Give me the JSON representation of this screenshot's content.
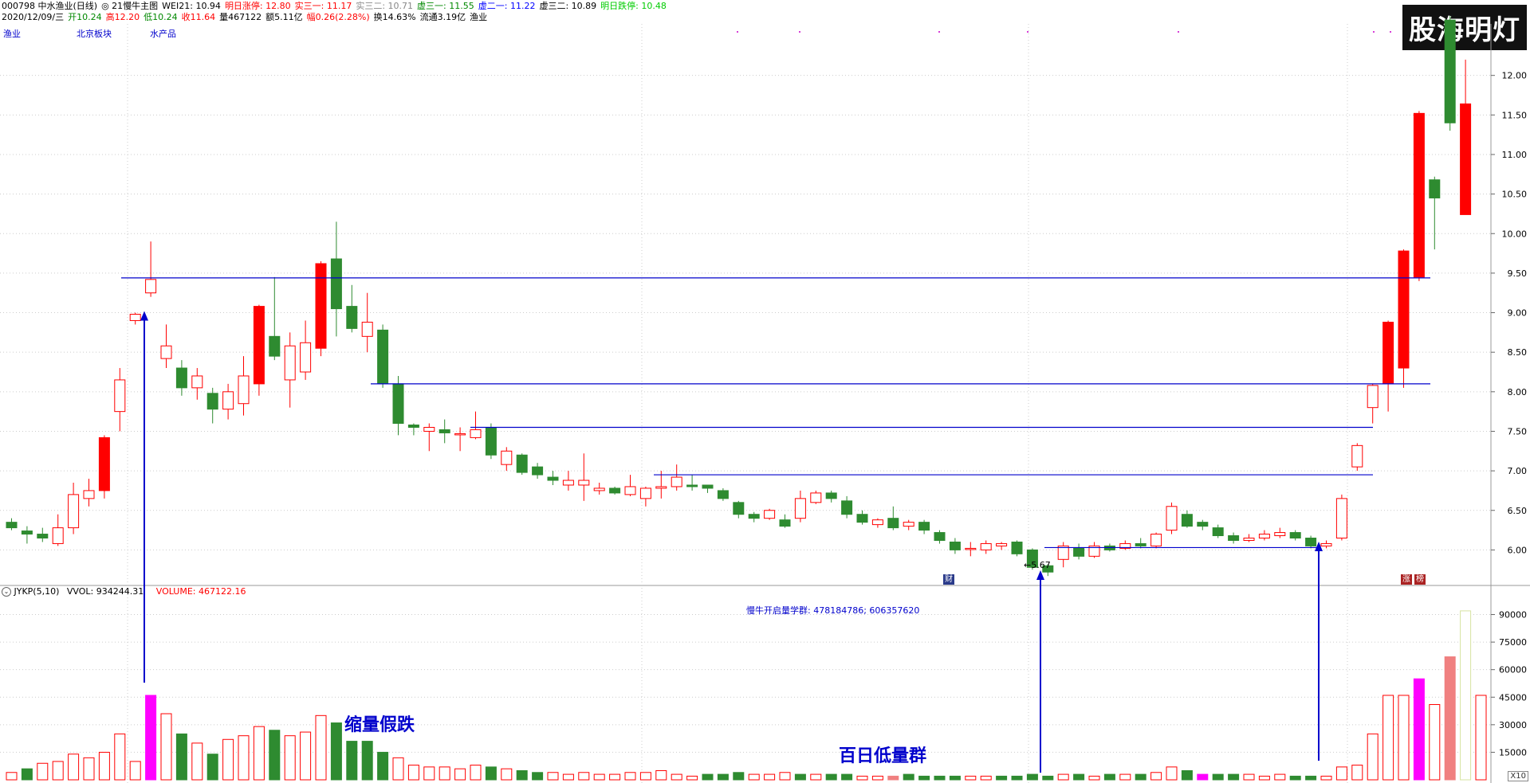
{
  "header": {
    "line1": [
      {
        "text": "000798 中水渔业(日线)",
        "color": "#000000"
      },
      {
        "text": "◎ 21慢牛主图",
        "color": "#000000"
      },
      {
        "text": "WEI21: 10.94",
        "color": "#000000"
      },
      {
        "text": "明日涨停: 12.80",
        "color": "#ff0000"
      },
      {
        "text": "实三一: 11.17",
        "color": "#ff0000"
      },
      {
        "text": "实三二: 10.71",
        "color": "#888888"
      },
      {
        "text": "虚三一: 11.55",
        "color": "#008800"
      },
      {
        "text": "虚二一: 11.22",
        "color": "#0000ff"
      },
      {
        "text": "虚三二: 10.89",
        "color": "#000000"
      },
      {
        "text": "明日跌停: 10.48",
        "color": "#00cc00"
      }
    ],
    "line2": [
      {
        "text": "2020/12/09/三",
        "color": "#000000"
      },
      {
        "text": "开10.24",
        "color": "#008800"
      },
      {
        "text": "高12.20",
        "color": "#ff0000"
      },
      {
        "text": "低10.24",
        "color": "#008800"
      },
      {
        "text": "收11.64",
        "color": "#ff0000"
      },
      {
        "text": "量467122",
        "color": "#000000"
      },
      {
        "text": "额5.11亿",
        "color": "#000000"
      },
      {
        "text": "幅0.26(2.28%)",
        "color": "#ff0000"
      },
      {
        "text": "换14.63%",
        "color": "#000000"
      },
      {
        "text": "流通3.19亿",
        "color": "#000000"
      },
      {
        "text": "渔业",
        "color": "#000000"
      }
    ]
  },
  "tags": [
    "渔业",
    "北京板块",
    "水产品"
  ],
  "watermark": "股海明灯",
  "price_axis_labels": [
    "12.00",
    "11.50",
    "11.00",
    "10.50",
    "10.00",
    "9.50",
    "9.00",
    "8.50",
    "8.00",
    "7.50",
    "7.00",
    "6.50",
    "6.00"
  ],
  "volume_axis_labels": [
    "90000",
    "75000",
    "60000",
    "45000",
    "30000",
    "15000"
  ],
  "low_label": "←5.67",
  "badges": [
    {
      "text": "财",
      "color": "#2a3a8a"
    },
    {
      "text": "涨",
      "color": "#aa2222"
    },
    {
      "text": "榜",
      "color": "#aa2222"
    }
  ],
  "indicator": {
    "name": "JYKP(5,10)",
    "vvol": "VVOL: 934244.31",
    "volume": "VOLUME: 467122.16",
    "group_note": "慢牛开启量学群: 478184786; 606357620"
  },
  "annotations": {
    "shrink": "缩量假跌",
    "low_volume": "百日低量群"
  },
  "x10_label": "X10",
  "colors": {
    "up": "#ff0000",
    "down": "#2e8b30",
    "line": "#0000cc",
    "grid": "#cccccc",
    "magenta": "#ff00ff",
    "salmon": "#f08080"
  },
  "chart_data": {
    "type": "candlestick",
    "price_range": [
      5.45,
      12.45
    ],
    "volume_range": [
      0,
      95000
    ],
    "candles": [
      [
        6.35,
        6.28,
        6.4,
        6.25
      ],
      [
        6.24,
        6.2,
        6.3,
        6.08
      ],
      [
        6.2,
        6.15,
        6.28,
        6.1
      ],
      [
        6.08,
        6.28,
        6.45,
        6.05
      ],
      [
        6.28,
        6.7,
        6.85,
        6.2
      ],
      [
        6.65,
        6.75,
        6.9,
        6.55
      ],
      [
        6.75,
        7.42,
        7.45,
        6.65
      ],
      [
        7.75,
        8.15,
        8.3,
        7.5
      ],
      [
        8.9,
        8.98,
        9.0,
        8.85
      ],
      [
        9.25,
        9.42,
        9.9,
        9.2
      ],
      [
        8.42,
        8.58,
        8.85,
        8.3
      ],
      [
        8.3,
        8.05,
        8.4,
        7.95
      ],
      [
        8.05,
        8.2,
        8.3,
        7.9
      ],
      [
        7.98,
        7.78,
        8.05,
        7.6
      ],
      [
        7.78,
        8.0,
        8.1,
        7.65
      ],
      [
        7.85,
        8.2,
        8.45,
        7.7
      ],
      [
        8.1,
        9.08,
        9.1,
        7.95
      ],
      [
        8.7,
        8.45,
        9.45,
        8.4
      ],
      [
        8.15,
        8.58,
        8.75,
        7.8
      ],
      [
        8.25,
        8.62,
        8.9,
        8.15
      ],
      [
        8.55,
        9.62,
        9.65,
        8.45
      ],
      [
        9.68,
        9.05,
        10.15,
        8.7
      ],
      [
        9.08,
        8.8,
        9.35,
        8.75
      ],
      [
        8.7,
        8.88,
        9.25,
        8.5
      ],
      [
        8.78,
        8.1,
        8.85,
        8.05
      ],
      [
        8.1,
        7.6,
        8.2,
        7.45
      ],
      [
        7.58,
        7.55,
        7.6,
        7.45
      ],
      [
        7.5,
        7.55,
        7.6,
        7.25
      ],
      [
        7.52,
        7.48,
        7.65,
        7.35
      ],
      [
        7.47,
        7.47,
        7.55,
        7.25
      ],
      [
        7.42,
        7.52,
        7.75,
        7.4
      ],
      [
        7.55,
        7.2,
        7.6,
        7.15
      ],
      [
        7.08,
        7.25,
        7.3,
        7.0
      ],
      [
        7.2,
        6.98,
        7.22,
        6.95
      ],
      [
        7.05,
        6.95,
        7.1,
        6.9
      ],
      [
        6.92,
        6.88,
        7.0,
        6.82
      ],
      [
        6.82,
        6.88,
        7.0,
        6.75
      ],
      [
        6.82,
        6.88,
        7.22,
        6.62
      ],
      [
        6.75,
        6.78,
        6.85,
        6.7
      ],
      [
        6.78,
        6.72,
        6.8,
        6.7
      ],
      [
        6.7,
        6.8,
        6.95,
        6.68
      ],
      [
        6.65,
        6.78,
        6.8,
        6.55
      ],
      [
        6.78,
        6.8,
        7.0,
        6.65
      ],
      [
        6.8,
        6.92,
        7.08,
        6.75
      ],
      [
        6.82,
        6.8,
        6.95,
        6.75
      ],
      [
        6.82,
        6.78,
        6.82,
        6.72
      ],
      [
        6.75,
        6.65,
        6.78,
        6.62
      ],
      [
        6.6,
        6.45,
        6.62,
        6.4
      ],
      [
        6.45,
        6.4,
        6.48,
        6.35
      ],
      [
        6.4,
        6.5,
        6.52,
        6.38
      ],
      [
        6.38,
        6.3,
        6.45,
        6.28
      ],
      [
        6.4,
        6.65,
        6.75,
        6.35
      ],
      [
        6.6,
        6.72,
        6.75,
        6.58
      ],
      [
        6.72,
        6.65,
        6.75,
        6.6
      ],
      [
        6.62,
        6.45,
        6.68,
        6.4
      ],
      [
        6.45,
        6.35,
        6.5,
        6.32
      ],
      [
        6.32,
        6.38,
        6.4,
        6.28
      ],
      [
        6.4,
        6.28,
        6.55,
        6.25
      ],
      [
        6.3,
        6.35,
        6.38,
        6.25
      ],
      [
        6.35,
        6.25,
        6.38,
        6.2
      ],
      [
        6.22,
        6.12,
        6.25,
        6.08
      ],
      [
        6.1,
        6.0,
        6.15,
        5.95
      ],
      [
        6.02,
        6.02,
        6.1,
        5.92
      ],
      [
        6.0,
        6.08,
        6.12,
        5.95
      ],
      [
        6.05,
        6.08,
        6.1,
        6.0
      ],
      [
        6.1,
        5.95,
        6.12,
        5.92
      ],
      [
        6.0,
        5.78,
        6.02,
        5.75
      ],
      [
        5.8,
        5.72,
        5.82,
        5.67
      ],
      [
        5.88,
        6.05,
        6.1,
        5.78
      ],
      [
        6.02,
        5.92,
        6.08,
        5.88
      ],
      [
        5.92,
        6.05,
        6.1,
        5.9
      ],
      [
        6.05,
        6.0,
        6.08,
        5.98
      ],
      [
        6.02,
        6.08,
        6.12,
        6.0
      ],
      [
        6.08,
        6.05,
        6.15,
        6.02
      ],
      [
        6.05,
        6.2,
        6.22,
        6.02
      ],
      [
        6.25,
        6.55,
        6.6,
        6.2
      ],
      [
        6.45,
        6.3,
        6.5,
        6.28
      ],
      [
        6.35,
        6.3,
        6.38,
        6.25
      ],
      [
        6.28,
        6.18,
        6.32,
        6.15
      ],
      [
        6.18,
        6.12,
        6.22,
        6.08
      ],
      [
        6.12,
        6.15,
        6.2,
        6.1
      ],
      [
        6.15,
        6.2,
        6.25,
        6.12
      ],
      [
        6.18,
        6.22,
        6.28,
        6.15
      ],
      [
        6.22,
        6.15,
        6.25,
        6.12
      ],
      [
        6.15,
        6.05,
        6.18,
        6.02
      ],
      [
        6.05,
        6.08,
        6.12,
        6.02
      ],
      [
        6.15,
        6.65,
        6.7,
        6.12
      ],
      [
        7.05,
        7.32,
        7.35,
        7.0
      ],
      [
        7.8,
        8.08,
        8.1,
        7.6
      ],
      [
        8.1,
        8.88,
        8.9,
        7.75
      ],
      [
        8.3,
        9.78,
        9.8,
        8.05
      ],
      [
        9.45,
        11.52,
        11.55,
        9.4
      ],
      [
        10.68,
        10.45,
        10.72,
        9.8
      ],
      [
        12.7,
        11.4,
        12.75,
        11.3
      ],
      [
        10.24,
        11.64,
        12.2,
        10.24
      ]
    ],
    "volumes": [
      [
        4000,
        1
      ],
      [
        6000,
        0
      ],
      [
        9000,
        1
      ],
      [
        10000,
        1
      ],
      [
        14000,
        1
      ],
      [
        12000,
        1
      ],
      [
        15000,
        1
      ],
      [
        25000,
        1
      ],
      [
        10000,
        1
      ],
      [
        46000,
        2
      ],
      [
        36000,
        1
      ],
      [
        25000,
        0
      ],
      [
        20000,
        1
      ],
      [
        14000,
        0
      ],
      [
        22000,
        1
      ],
      [
        24000,
        1
      ],
      [
        29000,
        1
      ],
      [
        27000,
        0
      ],
      [
        24000,
        1
      ],
      [
        26000,
        1
      ],
      [
        35000,
        1
      ],
      [
        31000,
        0
      ],
      [
        21000,
        0
      ],
      [
        21000,
        0
      ],
      [
        15000,
        0
      ],
      [
        12000,
        1
      ],
      [
        8000,
        1
      ],
      [
        7000,
        1
      ],
      [
        7000,
        1
      ],
      [
        6000,
        1
      ],
      [
        8000,
        1
      ],
      [
        7000,
        0
      ],
      [
        6000,
        1
      ],
      [
        5000,
        0
      ],
      [
        4000,
        0
      ],
      [
        4000,
        1
      ],
      [
        3000,
        1
      ],
      [
        4000,
        1
      ],
      [
        3000,
        1
      ],
      [
        3000,
        1
      ],
      [
        4000,
        1
      ],
      [
        4000,
        1
      ],
      [
        5000,
        1
      ],
      [
        3000,
        1
      ],
      [
        2000,
        1
      ],
      [
        3000,
        0
      ],
      [
        3000,
        0
      ],
      [
        4000,
        0
      ],
      [
        3000,
        1
      ],
      [
        3000,
        1
      ],
      [
        4000,
        1
      ],
      [
        3000,
        0
      ],
      [
        3000,
        1
      ],
      [
        3000,
        0
      ],
      [
        3000,
        0
      ],
      [
        2000,
        1
      ],
      [
        2000,
        1
      ],
      [
        2000,
        3
      ],
      [
        3000,
        0
      ],
      [
        2000,
        0
      ],
      [
        2000,
        0
      ],
      [
        2000,
        0
      ],
      [
        2000,
        1
      ],
      [
        2000,
        1
      ],
      [
        2000,
        0
      ],
      [
        2000,
        0
      ],
      [
        3000,
        0
      ],
      [
        2000,
        0
      ],
      [
        3000,
        1
      ],
      [
        3000,
        0
      ],
      [
        2000,
        1
      ],
      [
        3000,
        0
      ],
      [
        3000,
        1
      ],
      [
        3000,
        0
      ],
      [
        4000,
        1
      ],
      [
        7000,
        1
      ],
      [
        5000,
        0
      ],
      [
        3000,
        2
      ],
      [
        3000,
        0
      ],
      [
        3000,
        0
      ],
      [
        3000,
        1
      ],
      [
        2000,
        1
      ],
      [
        3000,
        1
      ],
      [
        2000,
        0
      ],
      [
        2000,
        0
      ],
      [
        2000,
        1
      ],
      [
        7000,
        1
      ],
      [
        8000,
        1
      ],
      [
        25000,
        1
      ],
      [
        46000,
        1
      ],
      [
        46000,
        1
      ],
      [
        55000,
        2
      ],
      [
        41000,
        1
      ],
      [
        67000,
        3
      ],
      [
        92000,
        4
      ],
      [
        46000,
        1
      ]
    ]
  }
}
